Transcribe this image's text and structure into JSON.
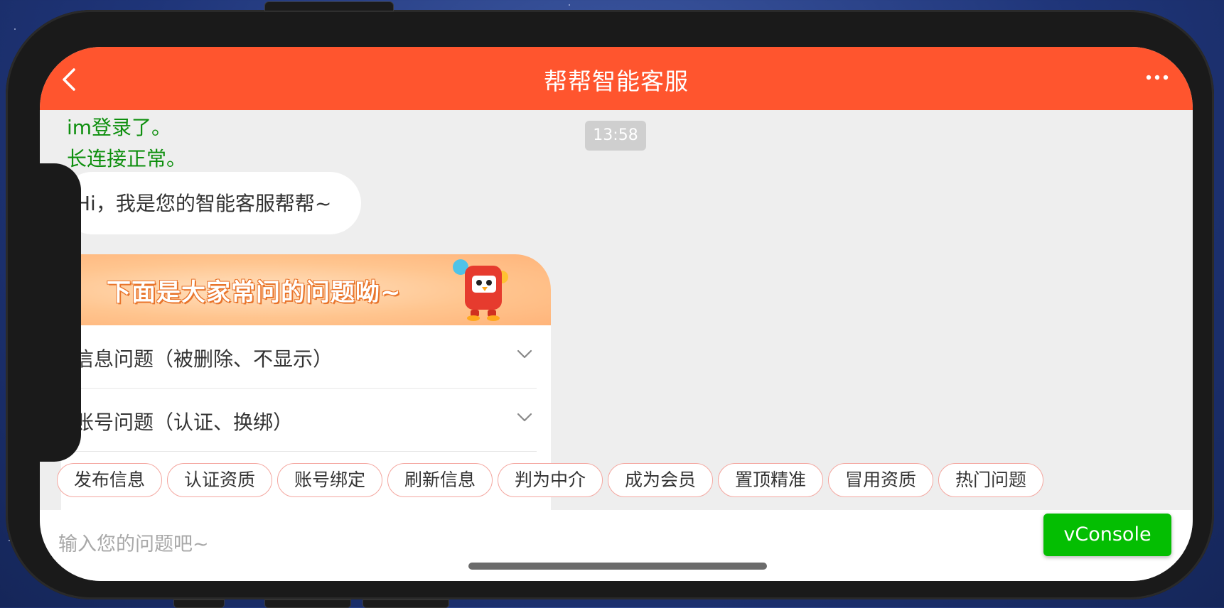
{
  "header": {
    "title": "帮帮智能客服",
    "back_icon": "chevron-left-icon",
    "more_icon": "more-dots-icon"
  },
  "chat": {
    "timestamp": "13:58",
    "log_lines": [
      "im登录了。",
      "长连接正常。"
    ],
    "greeting": "Hi，我是您的智能客服帮帮~",
    "faq": {
      "banner_text": "下面是大家常问的问题呦~",
      "items": [
        "信息问题（被删除、不显示）",
        "账号问题（认证、换绑）"
      ],
      "partial_hidden_item": "（                              ）"
    }
  },
  "quick_tags": [
    "发布信息",
    "认证资质",
    "账号绑定",
    "刷新信息",
    "判为中介",
    "成为会员",
    "置顶精准",
    "冒用资质",
    "热门问题"
  ],
  "input": {
    "placeholder": "输入您的问题吧~",
    "value": ""
  },
  "vconsole": {
    "label": "vConsole"
  },
  "colors": {
    "brand": "#ff552e",
    "log_green": "#0e8f0e",
    "vconsole_green": "#04be02",
    "tag_border": "#f4a7a0"
  }
}
